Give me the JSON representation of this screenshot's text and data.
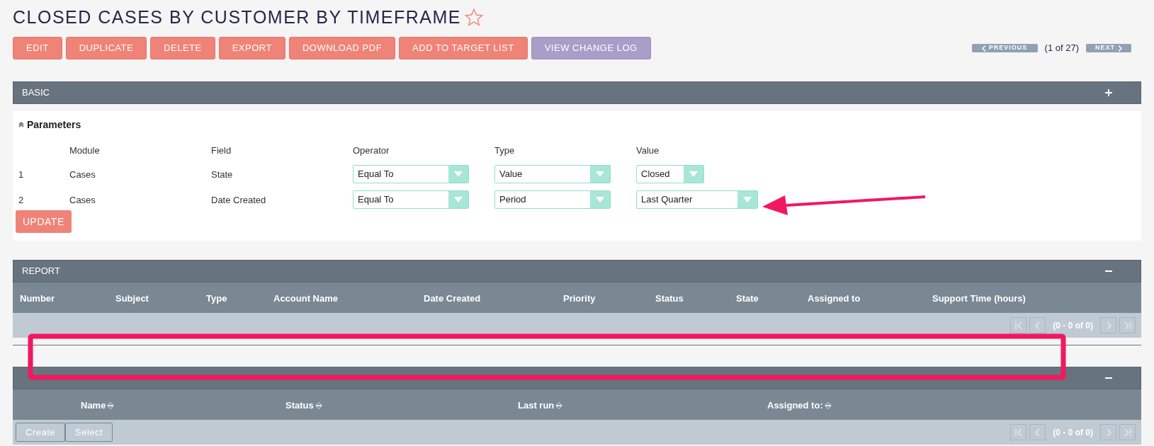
{
  "title": "CLOSED CASES BY CUSTOMER BY TIMEFRAME",
  "favorite": false,
  "actions": [
    {
      "label": "EDIT",
      "kind": "primary"
    },
    {
      "label": "DUPLICATE",
      "kind": "primary"
    },
    {
      "label": "DELETE",
      "kind": "primary"
    },
    {
      "label": "EXPORT",
      "kind": "primary"
    },
    {
      "label": "DOWNLOAD PDF",
      "kind": "primary"
    },
    {
      "label": "ADD TO TARGET LIST",
      "kind": "primary"
    },
    {
      "label": "VIEW CHANGE LOG",
      "kind": "secondary"
    }
  ],
  "pager": {
    "previous": "PREVIOUS",
    "position": "(1 of 27)",
    "next": "NEXT"
  },
  "basic_panel": {
    "title": "BASIC",
    "expanded": false
  },
  "parameters": {
    "title": "Parameters",
    "columns": [
      "Module",
      "Field",
      "Operator",
      "Type",
      "Value"
    ],
    "rows": [
      {
        "number": "1",
        "module": "Cases",
        "field": "State",
        "operator": "Equal To",
        "type": "Value",
        "value": "Closed"
      },
      {
        "number": "2",
        "module": "Cases",
        "field": "Date Created",
        "operator": "Equal To",
        "type": "Period",
        "value": "Last Quarter"
      }
    ],
    "update_button": "UPDATE"
  },
  "report_panel": {
    "title": "REPORT",
    "expanded": true,
    "columns": [
      "Number",
      "Subject",
      "Type",
      "Account Name",
      "Date Created",
      "Priority",
      "Status",
      "State",
      "Assigned to",
      "Support Time (hours)"
    ],
    "paging": "(0 - 0 of 0)"
  },
  "scheduled_panel": {
    "expanded": true,
    "columns": [
      "Name",
      "Status",
      "Last run",
      "Assigned to:"
    ],
    "buttons": [
      "Create",
      "Select"
    ],
    "paging": "(0 - 0 of 0)"
  }
}
